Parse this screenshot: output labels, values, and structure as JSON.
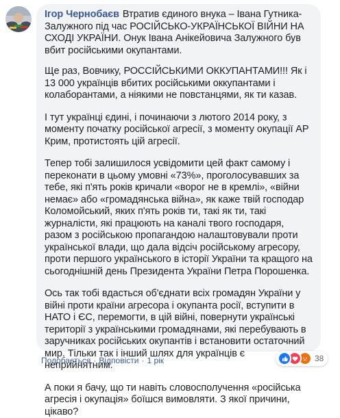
{
  "comment": {
    "author": "Ігор Чернобаєв",
    "paragraphs": [
      "Втратив єдиного внука – Івана Гутника-Залужного під час РОСІЙСЬКО-УКРАЇНСЬКОЇ ВІЙНИ НА СХОДІ УКРАЇНИ. Онук Івана Анікейовича Залужного був вбит російськими окупантами.",
      "Ще раз, Вовчику, РОССІЙСЬКИМИ ОККУПАНТАМИ!!! Як і 13 000 українців вбитих російськими оккупантами і колаборантами, а ніякими не повстанцями, як ти казав.",
      "І тут українці єдині, і починаючи з лютого 2014 року, з моменту початку російської агресії, з моменту окупації АР Крим, протистоять цій агресії.",
      "Тепер тобі залишилося усвідомити цей факт самому і переконати в цьому умовні «73%», проголосувавших за тебе, які п'ять років кричали «ворог не в кремлі», «війни немає» або «громадянська війна», як каже твій господар Коломойський, яких п'ять років ти, такі як ти, такі журналісти, які працюють на каналі твого господаря, разом з російською пропагандою налаштовували проти української влади, що дала відсіч російському агресору, проти першого українського в історії України та кращого на сьогоднішній день Президента України Петра Порошенка.",
      "Ось так тобі вдасться об'єднати всіх громадян України у війні проти країни агресора і окупанта росії, вступити в НАТО і ЄС, перемогти, в цій війні, повернути українські території з українськими громадянами, які перебувають в заручниках російських окупантів і встановити остаточний мир. Тільки так і інший шлях для українців є неприйнятним.",
      "А поки я бачу, що ти навіть словосполучення «російська агресія і окупація» боїшся вимовляти. З якої причини, цікаво?"
    ]
  },
  "actions": {
    "like": "Подобається",
    "reply": "Відповісти",
    "time": "1 рік",
    "separator": "·"
  },
  "reactions": {
    "count": "38",
    "icons": [
      "like-icon",
      "love-icon",
      "angry-icon"
    ]
  },
  "colors": {
    "author": "#385898",
    "bubble": "#f2f3f5",
    "like": "#1877f2",
    "love": "#f33e58",
    "angry": "#e9710f"
  }
}
